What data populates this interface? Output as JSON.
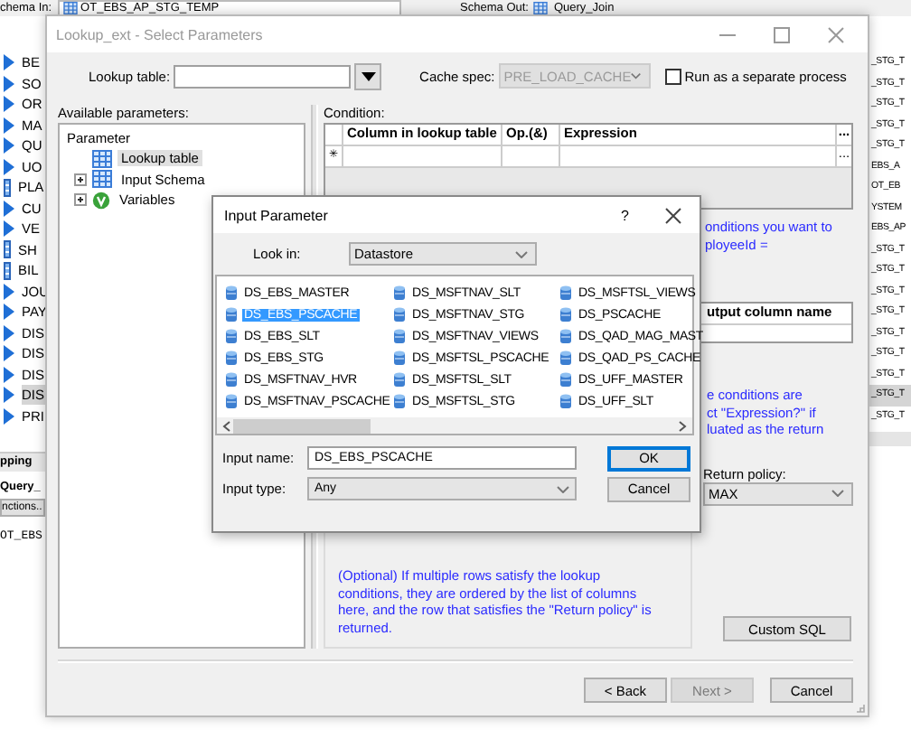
{
  "schema_bar": {
    "schema_in_label": "chema In:",
    "schema_in": "OT_EBS_AP_STG_TEMP",
    "schema_out_label": "Schema Out:",
    "schema_out": "Query_Join"
  },
  "left_list": [
    {
      "text": "BE",
      "kind": "arrow",
      "selected": false
    },
    {
      "text": "SO",
      "kind": "arrow",
      "selected": false
    },
    {
      "text": "OR",
      "kind": "arrow",
      "selected": false
    },
    {
      "text": "MA",
      "kind": "arrow",
      "selected": false
    },
    {
      "text": "QU",
      "kind": "arrow",
      "selected": false
    },
    {
      "text": "UO",
      "kind": "arrow",
      "selected": false
    },
    {
      "text": "PLA",
      "kind": "bar",
      "selected": false
    },
    {
      "text": "CU",
      "kind": "arrow",
      "selected": false
    },
    {
      "text": "VE",
      "kind": "arrow",
      "selected": false
    },
    {
      "text": "SH",
      "kind": "bar",
      "selected": false
    },
    {
      "text": "BIL",
      "kind": "bar",
      "selected": false
    },
    {
      "text": "JOU",
      "kind": "arrow",
      "selected": false
    },
    {
      "text": "PAY",
      "kind": "arrow",
      "selected": false
    },
    {
      "text": "DIS",
      "kind": "arrow",
      "selected": false
    },
    {
      "text": "DIS",
      "kind": "arrow",
      "selected": false
    },
    {
      "text": "DIS",
      "kind": "arrow",
      "selected": false
    },
    {
      "text": "DIS",
      "kind": "arrow",
      "selected": true
    },
    {
      "text": "PRI",
      "kind": "arrow",
      "selected": false
    }
  ],
  "left_lower": {
    "header": "pping",
    "query": "Query_",
    "functions_button": "nctions..",
    "code": "OT_EBS"
  },
  "right_list": [
    {
      "text": "_STG_T",
      "selected": false
    },
    {
      "text": "_STG_T",
      "selected": false
    },
    {
      "text": "_STG_T",
      "selected": false
    },
    {
      "text": "_STG_T",
      "selected": false
    },
    {
      "text": "_STG_T",
      "selected": false
    },
    {
      "text": "EBS_A",
      "selected": false
    },
    {
      "text": "OT_EB",
      "selected": false
    },
    {
      "text": "YSTEM",
      "selected": false
    },
    {
      "text": "EBS_AP",
      "selected": false
    },
    {
      "text": "_STG_T",
      "selected": false
    },
    {
      "text": "_STG_T",
      "selected": false
    },
    {
      "text": "_STG_T",
      "selected": false
    },
    {
      "text": "_STG_T",
      "selected": false
    },
    {
      "text": "_STG_T",
      "selected": false
    },
    {
      "text": "_STG_T",
      "selected": false
    },
    {
      "text": "_STG_T",
      "selected": false
    },
    {
      "text": "_STG_T",
      "selected": true
    },
    {
      "text": "_STG_T",
      "selected": false
    }
  ],
  "dialog": {
    "title": "Lookup_ext - Select Parameters",
    "lookup_table": {
      "label": "Lookup table:"
    },
    "cache_spec": {
      "label": "Cache spec:",
      "value": "PRE_LOAD_CACHE",
      "disabled": true
    },
    "separate_process": {
      "label": "Run as a separate process",
      "checked": false
    },
    "available_label": "Available parameters:",
    "tree": {
      "header": "Parameter",
      "items": [
        {
          "label": "Lookup table",
          "kind": "table",
          "selected": true
        },
        {
          "label": "Input Schema",
          "kind": "schema",
          "expanded": false,
          "selected": false
        },
        {
          "label": "Variables",
          "kind": "variables",
          "expanded": false,
          "selected": false
        }
      ]
    },
    "condition": {
      "label": "Condition:",
      "columns": [
        "Column in lookup table",
        "Op.(&)",
        "Expression",
        "..."
      ],
      "new_row_marker": "✳",
      "row_button": "...",
      "hint_lines": [
        "onditions you want to",
        "ployeeId ="
      ]
    },
    "output": {
      "columns": [
        "utput column name"
      ],
      "hint_lines": [
        "e conditions are",
        "ct \"Expression?\" if",
        "luated as the return"
      ]
    },
    "return_policy": {
      "label": "Return policy:",
      "value": "MAX"
    },
    "order_hint": [
      "(Optional) If multiple rows satisfy the lookup",
      "conditions, they are ordered by the list of columns",
      "here, and the row that satisfies the \"Return policy\" is",
      "returned."
    ],
    "custom_sql": "Custom SQL",
    "buttons": [
      {
        "label": "< Back",
        "disabled": false
      },
      {
        "label": "Next >",
        "disabled": true
      },
      {
        "label": "Cancel",
        "disabled": false
      }
    ]
  },
  "input_dialog": {
    "title": "Input Parameter",
    "help": "?",
    "look_in": {
      "label": "Look in:",
      "value": "Datastore"
    },
    "items": [
      {
        "label": "DS_EBS_MASTER",
        "selected": false
      },
      {
        "label": "DS_EBS_PSCACHE",
        "selected": true
      },
      {
        "label": "DS_EBS_SLT",
        "selected": false
      },
      {
        "label": "DS_EBS_STG",
        "selected": false
      },
      {
        "label": "DS_MSFTNAV_HVR",
        "selected": false
      },
      {
        "label": "DS_MSFTNAV_PSCACHE",
        "selected": false
      },
      {
        "label": "DS_MSFTNAV_SLT",
        "selected": false
      },
      {
        "label": "DS_MSFTNAV_STG",
        "selected": false
      },
      {
        "label": "DS_MSFTNAV_VIEWS",
        "selected": false
      },
      {
        "label": "DS_MSFTSL_PSCACHE",
        "selected": false
      },
      {
        "label": "DS_MSFTSL_SLT",
        "selected": false
      },
      {
        "label": "DS_MSFTSL_STG",
        "selected": false
      },
      {
        "label": "DS_MSFTSL_VIEWS",
        "selected": false
      },
      {
        "label": "DS_PSCACHE",
        "selected": false
      },
      {
        "label": "DS_QAD_MAG_MAST",
        "selected": false
      },
      {
        "label": "DS_QAD_PS_CACHE",
        "selected": false
      },
      {
        "label": "DS_UFF_MASTER",
        "selected": false
      },
      {
        "label": "DS_UFF_SLT",
        "selected": false
      }
    ],
    "input_name": {
      "label": "Input name:",
      "value": "DS_EBS_PSCACHE"
    },
    "input_type": {
      "label": "Input type:",
      "value": "Any"
    },
    "ok": "OK",
    "cancel": "Cancel"
  }
}
